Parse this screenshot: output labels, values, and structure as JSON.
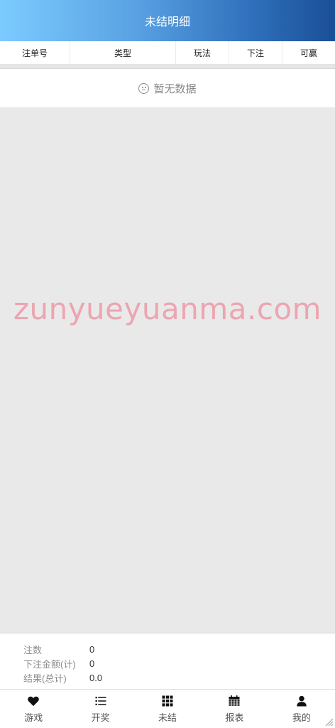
{
  "header": {
    "title": "未结明细"
  },
  "table": {
    "columns": [
      "注单号",
      "类型",
      "玩法",
      "下注",
      "可赢"
    ]
  },
  "empty": {
    "text": "暂无数据"
  },
  "watermark": "zunyueyuanma.com",
  "summary": {
    "rows": [
      {
        "label": "注数",
        "value": "0"
      },
      {
        "label": "下注金额(计)",
        "value": "0"
      },
      {
        "label": "结果(总计)",
        "value": "0.0"
      }
    ]
  },
  "tabbar": {
    "items": [
      {
        "label": "游戏",
        "icon": "heart-icon"
      },
      {
        "label": "开奖",
        "icon": "list-icon"
      },
      {
        "label": "未结",
        "icon": "grid-icon"
      },
      {
        "label": "报表",
        "icon": "calendar-icon"
      },
      {
        "label": "我的",
        "icon": "user-icon"
      }
    ]
  }
}
